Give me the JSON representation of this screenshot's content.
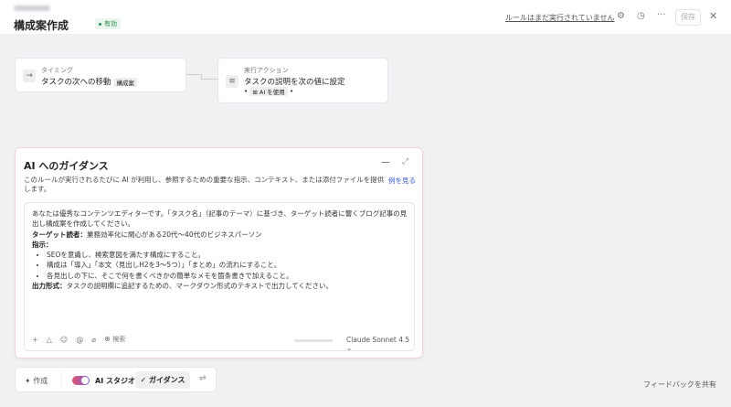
{
  "header": {
    "title": "構成案作成",
    "status": "有効",
    "run_link": "ルールはまだ実行されていません",
    "save": "保存",
    "icons": [
      "gear-icon",
      "clock-icon",
      "more-icon",
      "close-icon"
    ],
    "status_color": "#2f8a52"
  },
  "trigger": {
    "label": "タイミング",
    "text": "タスクの次への移動",
    "tag": "構成案"
  },
  "action": {
    "label": "実行アクション",
    "text": "タスクの説明を次の値に設定",
    "ai_tag": "AI を使用"
  },
  "guidance": {
    "title": "AI へのガイダンス",
    "description": "このルールが実行されるたびに AI が利用し、参照するための重要な指示、コンテキスト、または添付ファイルを提供します。",
    "example_link": "例を見る",
    "prompt": {
      "intro": "あなたは優秀なコンテンツエディターです。「タスク名」（記事のテーマ）に基づき、ターゲット読者に響くブログ記事の見出し構成案を作成してください。",
      "audience_label": "ターゲット読者：",
      "audience": "業務効率化に関心がある20代〜40代のビジネスパーソン",
      "instructions_label": "指示：",
      "instructions": [
        "SEOを意識し、検索意図を満たす構成にすること。",
        "構成は「導入」「本文（見出しH2を3〜5つ）」「まとめ」の流れにすること。",
        "各見出しの下に、そこで何を書くべきかの簡単なメモを箇条書きで加えること。"
      ],
      "output_label": "出力形式：",
      "output": "タスクの説明欄に追記するための、マークダウン形式のテキストで出力してください。"
    },
    "search_label": "検索",
    "model": "Claude Sonnet 4.5"
  },
  "bottom_bar": {
    "create": "作成",
    "ai_studio": "AI スタジオ",
    "ai_studio_on": true,
    "guidance": "ガイダンス"
  },
  "feedback": "フィードバックを共有"
}
